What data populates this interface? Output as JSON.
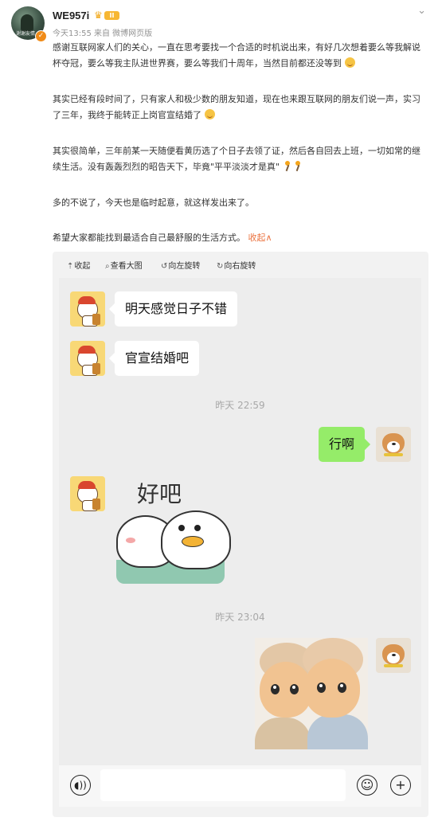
{
  "post": {
    "username": "WE957i",
    "level_badge": "II",
    "meta": "今天13:55  来自 微博网页版",
    "avatar_caption": "谢谢友情",
    "paragraphs": {
      "p1": "感谢互联网家人们的关心，一直在思考要找一个合适的时机说出来，有好几次想着要么等我解说杯夺冠，要么等我主队进世界赛，要么等我们十周年，当然目前都还没等到",
      "p2": "其实已经有段时间了，只有家人和极少数的朋友知道，现在也来跟互联网的朋友们说一声，实习了三年，我终于能转正上岗官宣结婚了",
      "p3": "其实很简单，三年前某一天随便看黄历选了个日子去领了证，然后各自回去上班，一切如常的继续生活。没有轰轰烈烈的昭告天下，毕竟\"平平淡淡才是真\"",
      "p4": "多的不说了，今天也是临时起意，就这样发出来了。",
      "p5": "希望大家都能找到最适合自己最舒服的生活方式。"
    },
    "collapse_label": "收起∧"
  },
  "toolbar": {
    "collapse": "收起",
    "view_large": "查看大图",
    "rotate_left": "向左旋转",
    "rotate_right": "向右旋转"
  },
  "chat": {
    "msg1": "明天感觉日子不错",
    "msg2": "官宣结婚吧",
    "time1": "昨天 22:59",
    "msg3": "行啊",
    "sticker_text": "好吧",
    "time2": "昨天 23:04"
  },
  "icons": {
    "menu": "chevron-down-icon",
    "voice": "voice-icon",
    "emoji": "emoji-icon",
    "plus": "plus-icon"
  },
  "colors": {
    "accent_link": "#eb7340",
    "bubble_green": "#95ec69",
    "chat_bg": "#ededed"
  }
}
